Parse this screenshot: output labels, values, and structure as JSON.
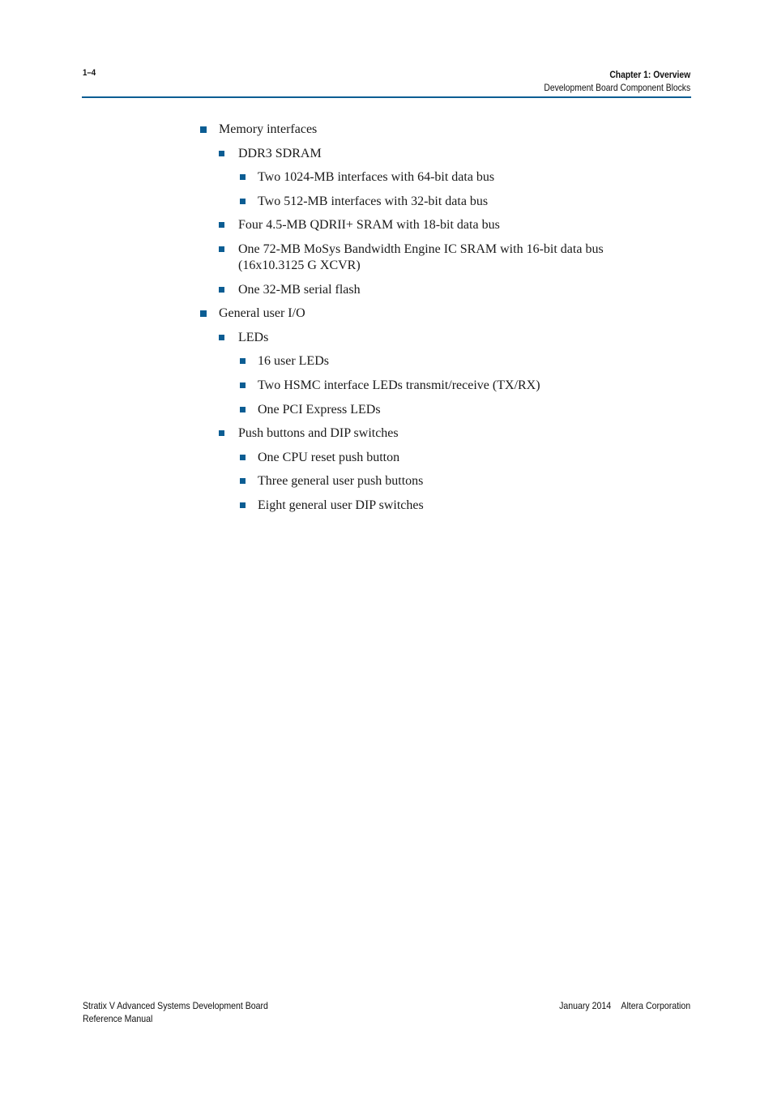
{
  "header": {
    "page_number": "1–4",
    "chapter": "Chapter 1:  Overview",
    "section": "Development Board Component Blocks",
    "accent_color": "#0b5d93"
  },
  "list": [
    {
      "level": 1,
      "text": "Memory interfaces"
    },
    {
      "level": 2,
      "text": "DDR3 SDRAM"
    },
    {
      "level": 3,
      "text": "Two 1024-MB interfaces with 64-bit data bus"
    },
    {
      "level": 3,
      "text": "Two 512-MB interfaces with 32-bit data bus"
    },
    {
      "level": 2,
      "text": "Four 4.5-MB QDRII+ SRAM with 18-bit data bus"
    },
    {
      "level": 2,
      "text": "One 72-MB MoSys Bandwidth Engine IC SRAM with 16-bit data bus",
      "continuation": "(16x10.3125 G XCVR)"
    },
    {
      "level": 2,
      "text": "One 32-MB serial flash"
    },
    {
      "level": 1,
      "text": "General user I/O"
    },
    {
      "level": 2,
      "text": "LEDs"
    },
    {
      "level": 3,
      "text": "16 user LEDs"
    },
    {
      "level": 3,
      "text": "Two HSMC interface LEDs transmit/receive (TX/RX)"
    },
    {
      "level": 3,
      "text": "One PCI Express LEDs"
    },
    {
      "level": 2,
      "text": "Push buttons and DIP switches"
    },
    {
      "level": 3,
      "text": "One CPU reset push button"
    },
    {
      "level": 3,
      "text": "Three general user push buttons"
    },
    {
      "level": 3,
      "text": "Eight general user DIP switches"
    }
  ],
  "footer": {
    "title_line1": "Stratix V Advanced Systems Development Board",
    "title_line2": "Reference Manual",
    "date": "January 2014",
    "company": "Altera Corporation"
  }
}
